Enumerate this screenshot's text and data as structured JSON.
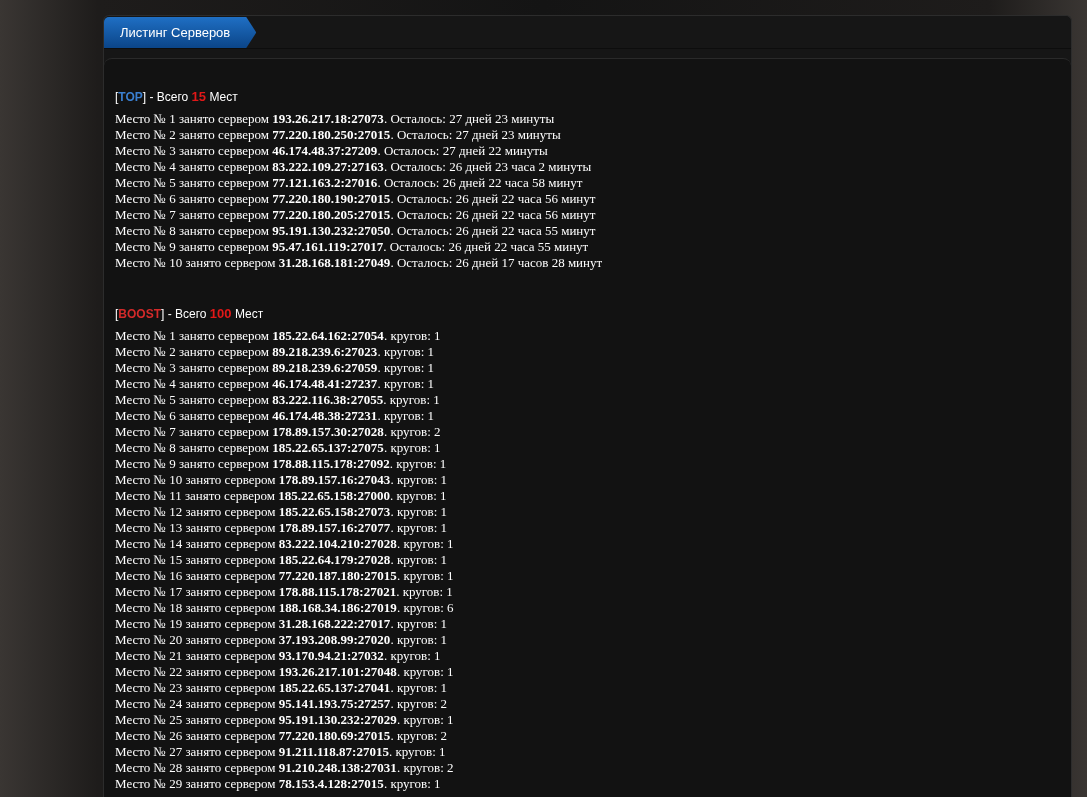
{
  "panel": {
    "tab": "Листинг Серверов"
  },
  "sections": [
    {
      "open": "[",
      "tag": "TOP",
      "color": "#3a7fd0",
      "middle": "] - Всего",
      "count": "15",
      "unit": "Мест",
      "rows": [
        "Место № 1 занято сервером **193.26.217.18:27073**. Осталось: 27 дней 23 минуты",
        "Место № 2 занято сервером **77.220.180.250:27015**. Осталось: 27 дней 23 минуты",
        "Место № 3 занято сервером **46.174.48.37:27209**. Осталось: 27 дней 22 минуты",
        "Место № 4 занято сервером **83.222.109.27:27163**. Осталось: 26 дней 23 часа 2 минуты",
        "Место № 5 занято сервером **77.121.163.2:27016**. Осталось: 26 дней 22 часа 58 минут",
        "Место № 6 занято сервером **77.220.180.190:27015**. Осталось: 26 дней 22 часа 56 минут",
        "Место № 7 занято сервером **77.220.180.205:27015**. Осталось: 26 дней 22 часа 56 минут",
        "Место № 8 занято сервером **95.191.130.232:27050**. Осталось: 26 дней 22 часа 55 минут",
        "Место № 9 занято сервером **95.47.161.119:27017**. Осталось: 26 дней 22 часа 55 минут",
        "Место № 10 занято сервером **31.28.168.181:27049**. Осталось: 26 дней 17 часов 28 минут"
      ]
    },
    {
      "open": "[",
      "tag": "BOOST",
      "color": "#d42a2a",
      "middle": "] - Всего",
      "count": "100",
      "unit": "Мест",
      "rows": [
        "Место № 1 занято сервером **185.22.64.162:27054**. кругов: 1",
        "Место № 2 занято сервером **89.218.239.6:27023**. кругов: 1",
        "Место № 3 занято сервером **89.218.239.6:27059**. кругов: 1",
        "Место № 4 занято сервером **46.174.48.41:27237**. кругов: 1",
        "Место № 5 занято сервером **83.222.116.38:27055**. кругов: 1",
        "Место № 6 занято сервером **46.174.48.38:27231**. кругов: 1",
        "Место № 7 занято сервером **178.89.157.30:27028**. кругов: 2",
        "Место № 8 занято сервером **185.22.65.137:27075**. кругов: 1",
        "Место № 9 занято сервером **178.88.115.178:27092**. кругов: 1",
        "Место № 10 занято сервером **178.89.157.16:27043**. кругов: 1",
        "Место № 11 занято сервером **185.22.65.158:27000**. кругов: 1",
        "Место № 12 занято сервером **185.22.65.158:27073**. кругов: 1",
        "Место № 13 занято сервером **178.89.157.16:27077**. кругов: 1",
        "Место № 14 занято сервером **83.222.104.210:27028**. кругов: 1",
        "Место № 15 занято сервером **185.22.64.179:27028**. кругов: 1",
        "Место № 16 занято сервером **77.220.187.180:27015**. кругов: 1",
        "Место № 17 занято сервером **178.88.115.178:27021**. кругов: 1",
        "Место № 18 занято сервером **188.168.34.186:27019**. кругов: 6",
        "Место № 19 занято сервером **31.28.168.222:27017**. кругов: 1",
        "Место № 20 занято сервером **37.193.208.99:27020**. кругов: 1",
        "Место № 21 занято сервером **93.170.94.21:27032**. кругов: 1",
        "Место № 22 занято сервером **193.26.217.101:27048**. кругов: 1",
        "Место № 23 занято сервером **185.22.65.137:27041**. кругов: 1",
        "Место № 24 занято сервером **95.141.193.75:27257**. кругов: 2",
        "Место № 25 занято сервером **95.191.130.232:27029**. кругов: 1",
        "Место № 26 занято сервером **77.220.180.69:27015**. кругов: 2",
        "Место № 27 занято сервером **91.211.118.87:27015**. кругов: 1",
        "Место № 28 занято сервером **91.210.248.138:27031**. кругов: 2",
        "Место № 29 занято сервером **78.153.4.128:27015**. кругов: 1"
      ]
    }
  ]
}
